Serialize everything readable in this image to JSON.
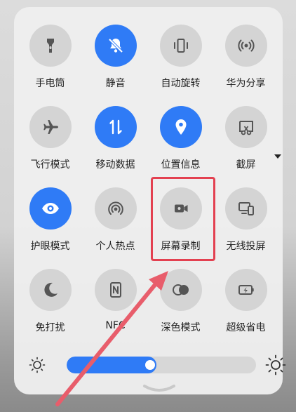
{
  "tiles": [
    {
      "label": "手电筒",
      "icon": "flashlight-icon",
      "active": false
    },
    {
      "label": "静音",
      "icon": "bell-off-icon",
      "active": true
    },
    {
      "label": "自动旋转",
      "icon": "auto-rotate-icon",
      "active": false
    },
    {
      "label": "华为分享",
      "icon": "huawei-share-icon",
      "active": false
    },
    {
      "label": "飞行模式",
      "icon": "airplane-icon",
      "active": false
    },
    {
      "label": "移动数据",
      "icon": "mobile-data-icon",
      "active": true
    },
    {
      "label": "位置信息",
      "icon": "location-icon",
      "active": true
    },
    {
      "label": "截屏",
      "icon": "screenshot-icon",
      "active": false,
      "has_dropdown": true
    },
    {
      "label": "护眼模式",
      "icon": "eye-icon",
      "active": true
    },
    {
      "label": "个人热点",
      "icon": "hotspot-icon",
      "active": false
    },
    {
      "label": "屏幕录制",
      "icon": "screen-record-icon",
      "active": false
    },
    {
      "label": "无线投屏",
      "icon": "wireless-projection-icon",
      "active": false
    },
    {
      "label": "免打扰",
      "icon": "moon-icon",
      "active": false
    },
    {
      "label": "NFC",
      "icon": "nfc-icon",
      "active": false
    },
    {
      "label": "深色模式",
      "icon": "dark-mode-icon",
      "active": false
    },
    {
      "label": "超级省电",
      "icon": "power-saving-icon",
      "active": false
    }
  ],
  "brightness": {
    "level": 0.45
  },
  "colors": {
    "accent": "#2f7bf6",
    "tile_off": "#d4d4d4",
    "highlight": "#e34050"
  }
}
